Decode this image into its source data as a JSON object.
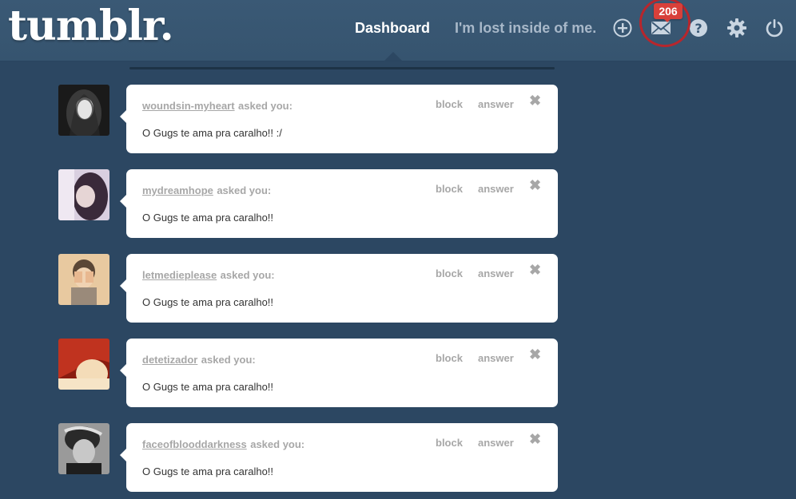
{
  "header": {
    "logo": "tumblr.",
    "nav": {
      "dashboard": "Dashboard",
      "blog": "I'm lost inside of me."
    },
    "icons": [
      "plus-circle-icon",
      "mail-icon",
      "help-icon",
      "gear-icon",
      "power-icon"
    ],
    "inbox_count": "206",
    "badge_color": "#d8403a",
    "highlight_color": "#b8262c"
  },
  "colors": {
    "background": "#2c4762",
    "card": "#ffffff",
    "muted_text": "#a7a7a7"
  },
  "posts": [
    {
      "asker": "woundsin-myheart",
      "asked_label": "asked you:",
      "question": "O Gugs te ama pra caralho!! :/",
      "block_label": "block",
      "answer_label": "answer",
      "close_label": "✖"
    },
    {
      "asker": "mydreamhope",
      "asked_label": "asked you:",
      "question": "O Gugs te ama pra caralho!!",
      "block_label": "block",
      "answer_label": "answer",
      "close_label": "✖"
    },
    {
      "asker": "letmedieplease",
      "asked_label": "asked you:",
      "question": "O Gugs te ama pra caralho!!",
      "block_label": "block",
      "answer_label": "answer",
      "close_label": "✖"
    },
    {
      "asker": "detetizador",
      "asked_label": "asked you:",
      "question": "O Gugs te ama pra caralho!!",
      "block_label": "block",
      "answer_label": "answer",
      "close_label": "✖"
    },
    {
      "asker": "faceofblooddarkness",
      "asked_label": "asked you:",
      "question": "O Gugs te ama pra caralho!!",
      "block_label": "block",
      "answer_label": "answer",
      "close_label": "✖"
    }
  ]
}
